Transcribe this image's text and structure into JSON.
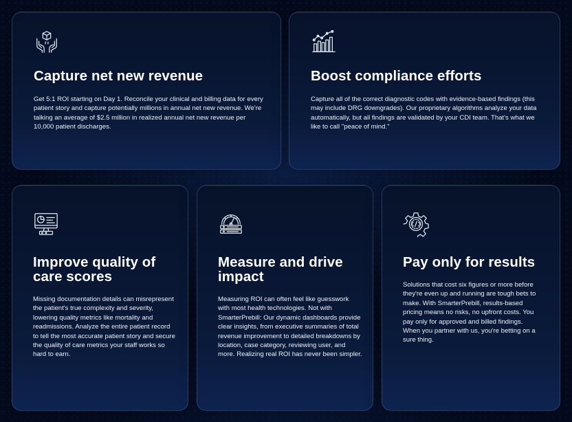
{
  "cards": [
    {
      "icon": "money-hands-icon",
      "title": "Capture net new revenue",
      "body": "Get 5:1 ROI starting on Day 1. Reconcile your clinical and billing data for every patient story and capture potentially millions in annual net new revenue. We're talking an average of $2.5 million in realized annual net new revenue per 10,000 patient discharges."
    },
    {
      "icon": "growth-chart-icon",
      "title": "Boost compliance efforts",
      "body": "Capture all of the correct diagnostic codes with evidence-based findings (this may include DRG downgrades). Our proprietary algorithms analyze your data automatically, but all findings are validated by your CDI team. That's what we like to call \"peace of mind.\""
    },
    {
      "icon": "monitor-dashboard-icon",
      "title": "Improve quality of care scores",
      "body": "Missing documentation details can misrepresent the patient's true complexity and severity, lowering quality metrics like mortality and readmissions. Analyze the entire patient record to tell the most accurate patient story and secure the quality of care metrics your staff works so hard to earn."
    },
    {
      "icon": "gauge-dashboard-icon",
      "title": "Measure and drive impact",
      "body": "Measuring ROI can often feel like guesswork with most health technologies. Not with SmarterPrebill: Our dynamic dashboards provide clear insights, from executive summaries of total revenue improvement to detailed breakdowns by location, case category, reviewing user, and more. Realizing real ROI has never been simpler."
    },
    {
      "icon": "gear-code-icon",
      "title": "Pay only for results",
      "body": "Solutions that cost six figures or more before they're even up and running are tough bets to make. With SmarterPrebill, results-based pricing means no risks, no upfront costs. You pay only for approved and billed findings. When you partner with us, you're betting on a sure thing."
    }
  ],
  "colors": {
    "background": "#040b1e",
    "card": "#0a1a3a",
    "icon_stroke": "#e6ecf6"
  }
}
